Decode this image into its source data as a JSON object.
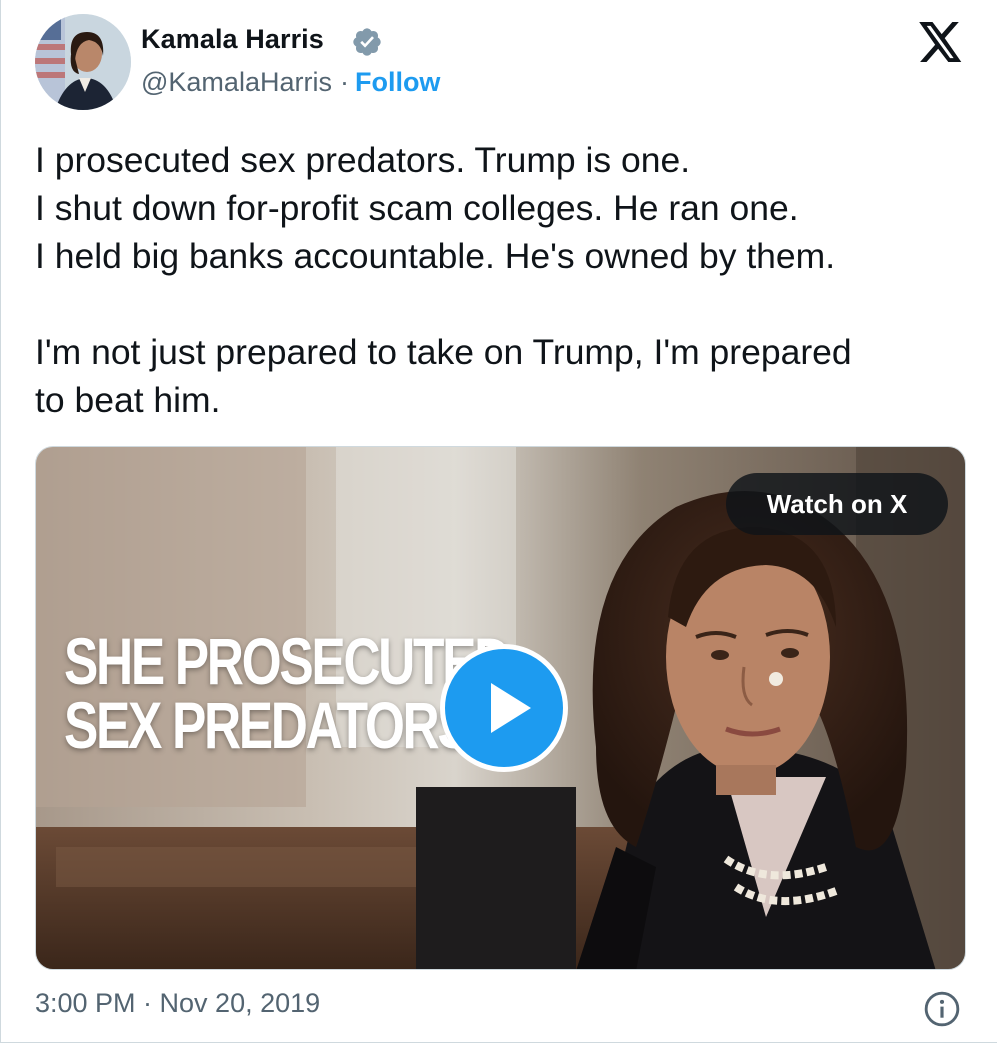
{
  "author": {
    "name": "Kamala Harris",
    "handle": "@KamalaHarris",
    "separator": "·",
    "follow_label": "Follow",
    "verified_icon": "verified-badge-icon",
    "avatar_icon": "profile-photo"
  },
  "platform_icon": "x-logo-icon",
  "tweet": {
    "lines": [
      "I prosecuted sex predators. Trump is one.",
      "I shut down for-profit scam colleges. He ran one.",
      "I held big banks accountable. He's owned by them.",
      "I'm not just prepared to take on Trump, I'm prepared",
      "to beat him."
    ]
  },
  "media": {
    "overlay_line1": "SHE PROSECUTED",
    "overlay_line2": "SEX PREDATORS",
    "watch_label": "Watch on X",
    "play_icon": "play-icon"
  },
  "footer": {
    "timestamp": "3:00 PM · Nov 20, 2019",
    "info_icon": "info-icon"
  },
  "colors": {
    "accent": "#1d9bf0",
    "text": "#0f1419",
    "secondary": "#536471"
  }
}
